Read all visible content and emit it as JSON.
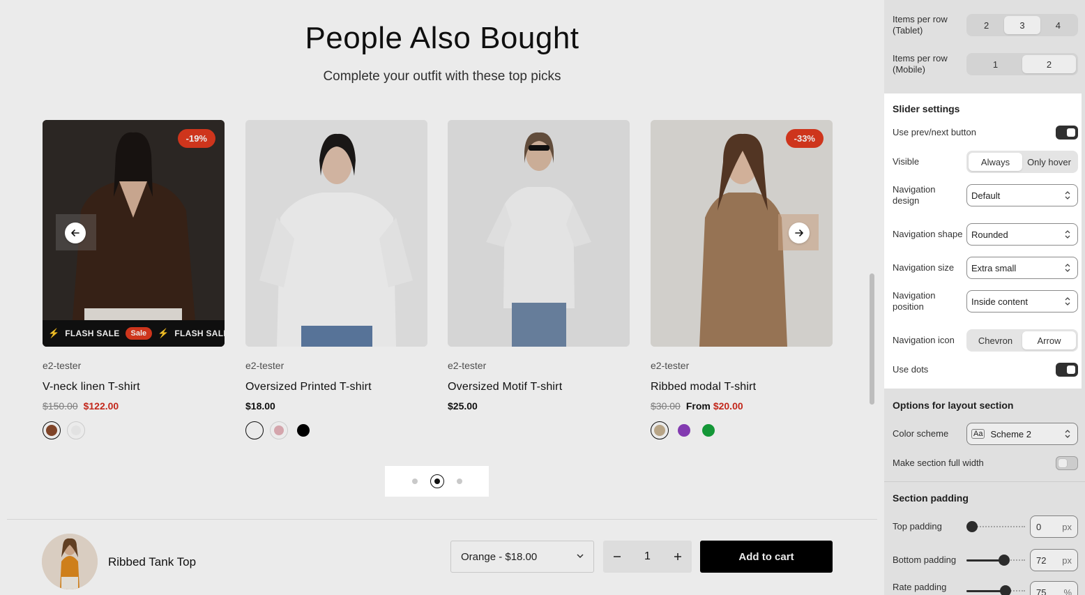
{
  "section": {
    "title": "People Also Bought",
    "subtitle": "Complete your outfit with these top picks"
  },
  "products": [
    {
      "vendor": "e2-tester",
      "name": "V-neck linen T-shirt",
      "price_old": "$150.00",
      "price": "$122.00",
      "price_prefix": "",
      "badge": "-19%",
      "image_color": "#3a2d28",
      "marquee": [
        "FLASH SALE",
        "Sale",
        "FLASH SALE"
      ],
      "swatches": [
        "#8a4a2c",
        "#f2f2f2"
      ]
    },
    {
      "vendor": "e2-tester",
      "name": "Oversized Printed T-shirt",
      "price_old": "",
      "price": "$18.00",
      "price_prefix": "",
      "badge": "",
      "image_color": "#ededed",
      "swatches": [
        "#ffffff",
        "#e7b4bb",
        "#000000"
      ]
    },
    {
      "vendor": "e2-tester",
      "name": "Oversized Motif T-shirt",
      "price_old": "",
      "price": "$25.00",
      "price_prefix": "",
      "badge": "",
      "image_color": "#e9e9e9",
      "swatches": []
    },
    {
      "vendor": "e2-tester",
      "name": "Ribbed modal T-shirt",
      "price_old": "$30.00",
      "price": "$20.00",
      "price_prefix": "From",
      "badge": "-33%",
      "image_color": "#e4e2df",
      "swatches": [
        "#c8b493",
        "#8e3fbf",
        "#16a43c"
      ]
    }
  ],
  "slider": {
    "prev_icon": "arrow-left-icon",
    "next_icon": "arrow-right-icon",
    "dots": 3,
    "active_dot": 1
  },
  "sticky_cart": {
    "product_name": "Ribbed Tank Top",
    "variant": "Orange - $18.00",
    "quantity": "1",
    "add_to_cart": "Add to cart",
    "minus": "−",
    "plus": "+"
  },
  "panel": {
    "items_tablet": {
      "label_line1": "Items per row",
      "label_line2": "(Tablet)",
      "options": [
        "2",
        "3",
        "4"
      ],
      "selected": 1
    },
    "items_mobile": {
      "label_line1": "Items per row",
      "label_line2": "(Mobile)",
      "options": [
        "1",
        "2"
      ],
      "selected": 1
    },
    "slider_settings": {
      "title": "Slider settings",
      "use_prev_next": {
        "label": "Use prev/next button",
        "on": true
      },
      "visible": {
        "label": "Visible",
        "options": [
          "Always",
          "Only hover"
        ],
        "selected": 0
      },
      "nav_design": {
        "label_line1": "Navigation",
        "label_line2": "design",
        "value": "Default"
      },
      "nav_shape": {
        "label": "Navigation shape",
        "value": "Rounded"
      },
      "nav_size": {
        "label": "Navigation size",
        "value": "Extra small"
      },
      "nav_position": {
        "label_line1": "Navigation",
        "label_line2": "position",
        "value": "Inside content"
      },
      "nav_icon": {
        "label": "Navigation icon",
        "options": [
          "Chevron",
          "Arrow"
        ],
        "selected": 1
      },
      "use_dots": {
        "label": "Use dots",
        "on": true
      }
    },
    "layout_options": {
      "title": "Options for layout section",
      "color_scheme": {
        "label": "Color scheme",
        "value": "Scheme 2",
        "icon_text": "Aa"
      },
      "full_width": {
        "label": "Make section full width",
        "on": false
      }
    },
    "section_padding": {
      "title": "Section padding",
      "top": {
        "label": "Top padding",
        "value": "0",
        "unit": "px",
        "fraction": 0.0
      },
      "bottom": {
        "label": "Bottom padding",
        "value": "72",
        "unit": "px",
        "fraction": 0.72
      },
      "rate": {
        "label": "Rate padding",
        "value": "75",
        "unit": "%",
        "fraction": 0.75
      }
    }
  }
}
